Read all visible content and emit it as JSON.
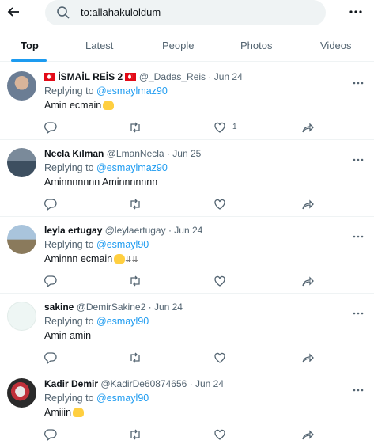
{
  "search": {
    "query": "to:allahakuloldum"
  },
  "tabs": [
    {
      "label": "Top"
    },
    {
      "label": "Latest"
    },
    {
      "label": "People"
    },
    {
      "label": "Photos"
    },
    {
      "label": "Videos"
    }
  ],
  "colors": {
    "accent": "#1d9bf0",
    "muted": "#536471"
  },
  "tweets": [
    {
      "display_name": "İSMAİL REİS 2",
      "handle": "@_Dadas_Reis",
      "date": "Jun 24",
      "replying_to": "Replying to",
      "mention": "@esmaylmaz90",
      "text": "Amin ecmain",
      "like_count": "1"
    },
    {
      "display_name": "Necla Kılman",
      "handle": "@LmanNecla",
      "date": "Jun 25",
      "replying_to": "Replying to",
      "mention": "@esmaylmaz90",
      "text": "Aminnnnnnn Aminnnnnnn",
      "like_count": ""
    },
    {
      "display_name": "leyla ertugay",
      "handle": "@leylaertugay",
      "date": "Jun 24",
      "replying_to": "Replying to",
      "mention": "@esmayl90",
      "text": "Aminnn ecmain",
      "like_count": ""
    },
    {
      "display_name": "sakine",
      "handle": "@DemirSakine2",
      "date": "Jun 24",
      "replying_to": "Replying to",
      "mention": "@esmayl90",
      "text": "Amin amin",
      "like_count": ""
    },
    {
      "display_name": "Kadir Demir",
      "handle": "@KadirDe60874656",
      "date": "Jun 24",
      "replying_to": "Replying to",
      "mention": "@esmayl90",
      "text": "Amiiin",
      "like_count": ""
    }
  ]
}
